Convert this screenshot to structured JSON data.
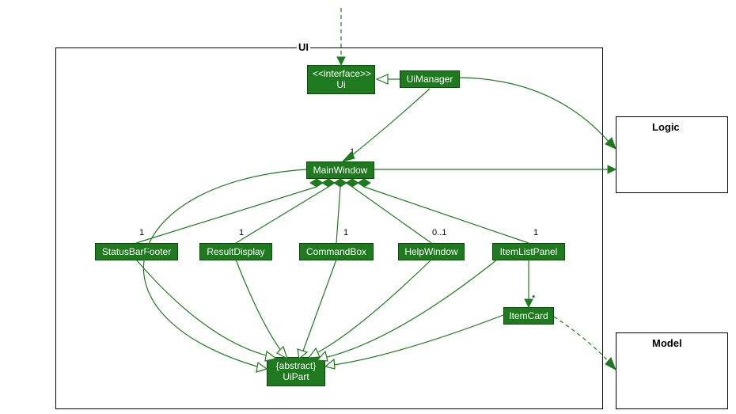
{
  "package": {
    "ui_label": "UI",
    "logic_label": "Logic",
    "model_label": "Model"
  },
  "classes": {
    "ui_interface": {
      "stereo": "<<interface>>",
      "name": "Ui"
    },
    "ui_manager": "UiManager",
    "main_window": "MainWindow",
    "status_bar_footer": "StatusBarFooter",
    "result_display": "ResultDisplay",
    "command_box": "CommandBox",
    "help_window": "HelpWindow",
    "item_list_panel": "ItemListPanel",
    "item_card": "ItemCard",
    "ui_part": {
      "stereo": "{abstract}",
      "name": "UiPart"
    }
  },
  "multiplicities": {
    "main_window": "1",
    "status_bar_footer": "1",
    "result_display": "1",
    "command_box": "1",
    "help_window": "0..1",
    "item_list_panel": "1",
    "item_card": "*"
  },
  "chart_data": {
    "type": "diagram",
    "diagram_kind": "uml-class",
    "packages": [
      "UI",
      "Logic",
      "Model"
    ],
    "classes": [
      {
        "name": "Ui",
        "stereotype": "interface",
        "package": "UI"
      },
      {
        "name": "UiManager",
        "package": "UI"
      },
      {
        "name": "MainWindow",
        "package": "UI"
      },
      {
        "name": "StatusBarFooter",
        "package": "UI"
      },
      {
        "name": "ResultDisplay",
        "package": "UI"
      },
      {
        "name": "CommandBox",
        "package": "UI"
      },
      {
        "name": "HelpWindow",
        "package": "UI"
      },
      {
        "name": "ItemListPanel",
        "package": "UI"
      },
      {
        "name": "ItemCard",
        "package": "UI"
      },
      {
        "name": "UiPart",
        "stereotype": "abstract",
        "package": "UI"
      }
    ],
    "relationships": [
      {
        "from": "(external)",
        "to": "Ui",
        "type": "dependency"
      },
      {
        "from": "UiManager",
        "to": "Ui",
        "type": "realization"
      },
      {
        "from": "UiManager",
        "to": "MainWindow",
        "type": "association",
        "multiplicity_to": "1"
      },
      {
        "from": "UiManager",
        "to": "Logic",
        "type": "association"
      },
      {
        "from": "MainWindow",
        "to": "Logic",
        "type": "association"
      },
      {
        "from": "MainWindow",
        "to": "StatusBarFooter",
        "type": "composition",
        "multiplicity_to": "1"
      },
      {
        "from": "MainWindow",
        "to": "ResultDisplay",
        "type": "composition",
        "multiplicity_to": "1"
      },
      {
        "from": "MainWindow",
        "to": "CommandBox",
        "type": "composition",
        "multiplicity_to": "1"
      },
      {
        "from": "MainWindow",
        "to": "HelpWindow",
        "type": "composition",
        "multiplicity_to": "0..1"
      },
      {
        "from": "MainWindow",
        "to": "ItemListPanel",
        "type": "composition",
        "multiplicity_to": "1"
      },
      {
        "from": "ItemListPanel",
        "to": "ItemCard",
        "type": "association",
        "multiplicity_to": "*"
      },
      {
        "from": "ItemCard",
        "to": "Model",
        "type": "dependency"
      },
      {
        "from": "MainWindow",
        "to": "UiPart",
        "type": "generalization"
      },
      {
        "from": "StatusBarFooter",
        "to": "UiPart",
        "type": "generalization"
      },
      {
        "from": "ResultDisplay",
        "to": "UiPart",
        "type": "generalization"
      },
      {
        "from": "CommandBox",
        "to": "UiPart",
        "type": "generalization"
      },
      {
        "from": "HelpWindow",
        "to": "UiPart",
        "type": "generalization"
      },
      {
        "from": "ItemListPanel",
        "to": "UiPart",
        "type": "generalization"
      },
      {
        "from": "ItemCard",
        "to": "UiPart",
        "type": "generalization"
      }
    ]
  }
}
